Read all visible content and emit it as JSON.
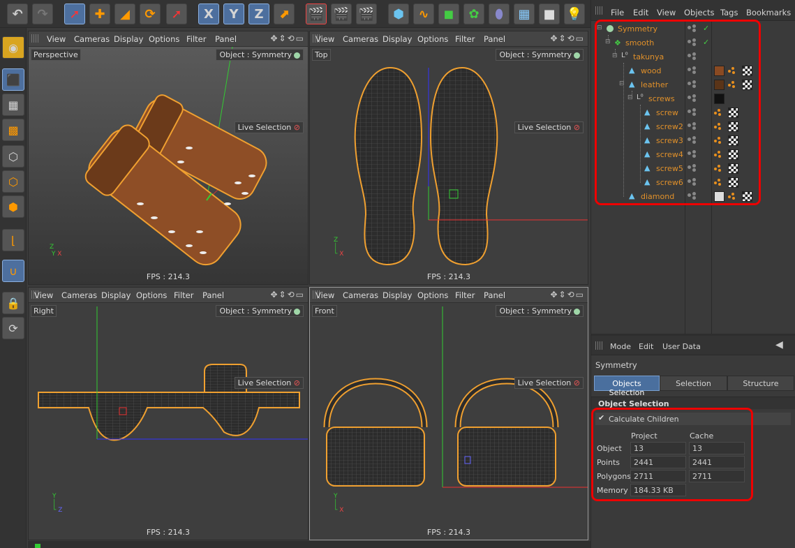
{
  "toolbar": {
    "undo": "↶",
    "redo": "↷",
    "x_axis": "X",
    "y_axis": "Y",
    "z_axis": "Z"
  },
  "viewports": {
    "menu": [
      "View",
      "Cameras",
      "Display",
      "Options",
      "Filter",
      "Panel"
    ],
    "perspective": {
      "name": "Perspective",
      "object": "Object : Symmetry",
      "live": "Live Selection",
      "fps": "FPS : 214.3"
    },
    "top": {
      "name": "Top",
      "object": "Object : Symmetry",
      "live": "Live Selection",
      "fps": "FPS : 214.3"
    },
    "right": {
      "name": "Right",
      "object": "Object : Symmetry",
      "live": "Live Selection",
      "fps": "FPS : 214.3"
    },
    "front": {
      "name": "Front",
      "object": "Object : Symmetry",
      "live": "Live Selection",
      "fps": "FPS : 214.3"
    }
  },
  "object_manager": {
    "menu": [
      "File",
      "Edit",
      "View",
      "Objects",
      "Tags",
      "Bookmarks"
    ],
    "objects": [
      {
        "name": "Symmetry"
      },
      {
        "name": "smooth"
      },
      {
        "name": "takunya"
      },
      {
        "name": "wood"
      },
      {
        "name": "leather"
      },
      {
        "name": "screws"
      },
      {
        "name": "screw"
      },
      {
        "name": "screw2"
      },
      {
        "name": "screw3"
      },
      {
        "name": "screw4"
      },
      {
        "name": "screw5"
      },
      {
        "name": "screw6"
      },
      {
        "name": "diamond"
      }
    ]
  },
  "attributes": {
    "menu": [
      "Mode",
      "Edit",
      "User Data"
    ],
    "object_name": "Symmetry",
    "tabs": [
      "Objects Selection",
      "Selection",
      "Structure"
    ],
    "section": "Object Selection",
    "calc_children": "Calculate Children",
    "col_project": "Project",
    "col_cache": "Cache",
    "rows": [
      {
        "label": "Object",
        "project": "13",
        "cache": "13"
      },
      {
        "label": "Points",
        "project": "2441",
        "cache": "2441"
      },
      {
        "label": "Polygons",
        "project": "2711",
        "cache": "2711"
      },
      {
        "label": "Memory",
        "project": "184.33 KB",
        "cache": ""
      }
    ]
  },
  "colors": {
    "accent": "#e0902a",
    "selection": "#4a6f9e",
    "highlight_box": "#e00000"
  }
}
